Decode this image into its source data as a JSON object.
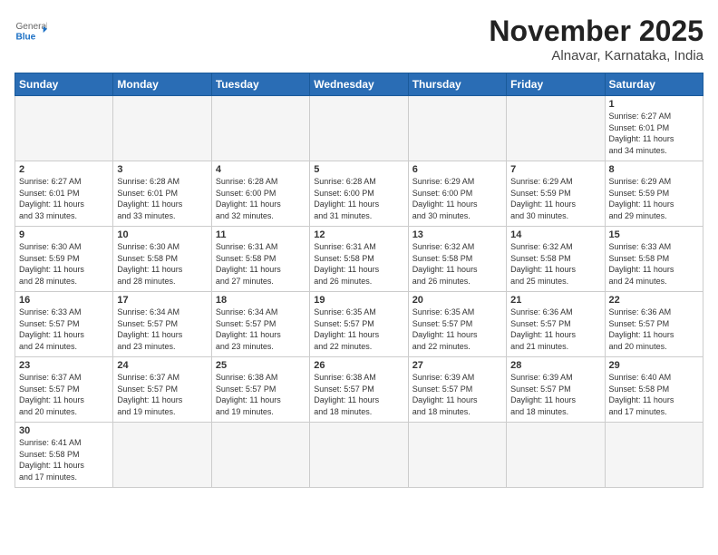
{
  "header": {
    "logo_general": "General",
    "logo_blue": "Blue",
    "month": "November 2025",
    "location": "Alnavar, Karnataka, India"
  },
  "weekdays": [
    "Sunday",
    "Monday",
    "Tuesday",
    "Wednesday",
    "Thursday",
    "Friday",
    "Saturday"
  ],
  "days": [
    {
      "number": "",
      "info": ""
    },
    {
      "number": "",
      "info": ""
    },
    {
      "number": "",
      "info": ""
    },
    {
      "number": "",
      "info": ""
    },
    {
      "number": "",
      "info": ""
    },
    {
      "number": "",
      "info": ""
    },
    {
      "number": "1",
      "sunrise": "6:27 AM",
      "sunset": "6:01 PM",
      "daylight": "11 hours and 34 minutes."
    },
    {
      "number": "2",
      "sunrise": "6:27 AM",
      "sunset": "6:01 PM",
      "daylight": "11 hours and 33 minutes."
    },
    {
      "number": "3",
      "sunrise": "6:28 AM",
      "sunset": "6:01 PM",
      "daylight": "11 hours and 33 minutes."
    },
    {
      "number": "4",
      "sunrise": "6:28 AM",
      "sunset": "6:00 PM",
      "daylight": "11 hours and 32 minutes."
    },
    {
      "number": "5",
      "sunrise": "6:28 AM",
      "sunset": "6:00 PM",
      "daylight": "11 hours and 31 minutes."
    },
    {
      "number": "6",
      "sunrise": "6:29 AM",
      "sunset": "6:00 PM",
      "daylight": "11 hours and 30 minutes."
    },
    {
      "number": "7",
      "sunrise": "6:29 AM",
      "sunset": "5:59 PM",
      "daylight": "11 hours and 30 minutes."
    },
    {
      "number": "8",
      "sunrise": "6:29 AM",
      "sunset": "5:59 PM",
      "daylight": "11 hours and 29 minutes."
    },
    {
      "number": "9",
      "sunrise": "6:30 AM",
      "sunset": "5:59 PM",
      "daylight": "11 hours and 28 minutes."
    },
    {
      "number": "10",
      "sunrise": "6:30 AM",
      "sunset": "5:58 PM",
      "daylight": "11 hours and 28 minutes."
    },
    {
      "number": "11",
      "sunrise": "6:31 AM",
      "sunset": "5:58 PM",
      "daylight": "11 hours and 27 minutes."
    },
    {
      "number": "12",
      "sunrise": "6:31 AM",
      "sunset": "5:58 PM",
      "daylight": "11 hours and 26 minutes."
    },
    {
      "number": "13",
      "sunrise": "6:32 AM",
      "sunset": "5:58 PM",
      "daylight": "11 hours and 26 minutes."
    },
    {
      "number": "14",
      "sunrise": "6:32 AM",
      "sunset": "5:58 PM",
      "daylight": "11 hours and 25 minutes."
    },
    {
      "number": "15",
      "sunrise": "6:33 AM",
      "sunset": "5:58 PM",
      "daylight": "11 hours and 24 minutes."
    },
    {
      "number": "16",
      "sunrise": "6:33 AM",
      "sunset": "5:57 PM",
      "daylight": "11 hours and 24 minutes."
    },
    {
      "number": "17",
      "sunrise": "6:34 AM",
      "sunset": "5:57 PM",
      "daylight": "11 hours and 23 minutes."
    },
    {
      "number": "18",
      "sunrise": "6:34 AM",
      "sunset": "5:57 PM",
      "daylight": "11 hours and 23 minutes."
    },
    {
      "number": "19",
      "sunrise": "6:35 AM",
      "sunset": "5:57 PM",
      "daylight": "11 hours and 22 minutes."
    },
    {
      "number": "20",
      "sunrise": "6:35 AM",
      "sunset": "5:57 PM",
      "daylight": "11 hours and 22 minutes."
    },
    {
      "number": "21",
      "sunrise": "6:36 AM",
      "sunset": "5:57 PM",
      "daylight": "11 hours and 21 minutes."
    },
    {
      "number": "22",
      "sunrise": "6:36 AM",
      "sunset": "5:57 PM",
      "daylight": "11 hours and 20 minutes."
    },
    {
      "number": "23",
      "sunrise": "6:37 AM",
      "sunset": "5:57 PM",
      "daylight": "11 hours and 20 minutes."
    },
    {
      "number": "24",
      "sunrise": "6:37 AM",
      "sunset": "5:57 PM",
      "daylight": "11 hours and 19 minutes."
    },
    {
      "number": "25",
      "sunrise": "6:38 AM",
      "sunset": "5:57 PM",
      "daylight": "11 hours and 19 minutes."
    },
    {
      "number": "26",
      "sunrise": "6:38 AM",
      "sunset": "5:57 PM",
      "daylight": "11 hours and 18 minutes."
    },
    {
      "number": "27",
      "sunrise": "6:39 AM",
      "sunset": "5:57 PM",
      "daylight": "11 hours and 18 minutes."
    },
    {
      "number": "28",
      "sunrise": "6:39 AM",
      "sunset": "5:57 PM",
      "daylight": "11 hours and 18 minutes."
    },
    {
      "number": "29",
      "sunrise": "6:40 AM",
      "sunset": "5:58 PM",
      "daylight": "11 hours and 17 minutes."
    },
    {
      "number": "30",
      "sunrise": "6:41 AM",
      "sunset": "5:58 PM",
      "daylight": "11 hours and 17 minutes."
    }
  ]
}
